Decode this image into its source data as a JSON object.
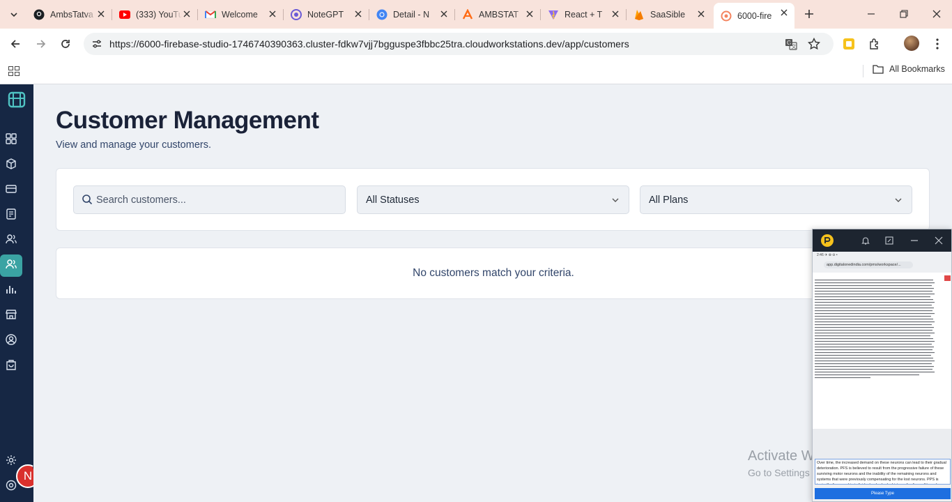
{
  "browser": {
    "tabs": [
      {
        "title": "AmbsTatva",
        "icon": "github-icon"
      },
      {
        "title": "(333) YouTube",
        "icon": "youtube-icon"
      },
      {
        "title": "Welcome",
        "icon": "gmail-icon"
      },
      {
        "title": "NoteGPT",
        "icon": "notegpt-icon"
      },
      {
        "title": "Detail - N",
        "icon": "chrome-icon"
      },
      {
        "title": "AMBSTAT",
        "icon": "ambstat-icon"
      },
      {
        "title": "React + T",
        "icon": "vite-icon"
      },
      {
        "title": "SaaSible",
        "icon": "firebase-icon"
      },
      {
        "title": "6000-fire",
        "icon": "firebase-studio-icon",
        "active": true
      }
    ],
    "url": "https://6000-firebase-studio-1746740390363.cluster-fdkw7vjj7bgguspe3fbbc25tra.cloudworkstations.dev/app/customers",
    "bookmarks_label": "All Bookmarks"
  },
  "page": {
    "title": "Customer Management",
    "subtitle": "View and manage your customers.",
    "search_placeholder": "Search customers...",
    "status_filter": "All Statuses",
    "plan_filter": "All Plans",
    "empty_message": "No customers match your criteria."
  },
  "user": {
    "avatar_initial": "N"
  },
  "watermark": {
    "line1": "Activate Windows",
    "line2": "Go to Settings to activate Windows."
  },
  "overlay": {
    "status_bar": "2:46  ✈  ⊕  ⊖  •",
    "url": "app.digitalonedindia.com/pms/workspace/...",
    "input_text": "Over time, the increased demand on these neurons can lead to their gradual deterioration. PFS is believed to result from the progressive failure of these surviving motor neurons and the inability of the remaining neurons and systems that were previously compensating for the lost neurons. PPS is typically diagnosed in individuals who had a history of poliomyelitis and experience new symptoms.",
    "button_label": "Please Type",
    "colors": {
      "button": "#1e6fe0",
      "header": "#1d2530"
    }
  },
  "colors": {
    "sidebar": "#162744",
    "sidebar_active": "#3aa3a3",
    "page_bg": "#eef1f5",
    "title": "#1a2238",
    "tabbar": "#f8e3dc",
    "avatar": "#d9302c"
  }
}
